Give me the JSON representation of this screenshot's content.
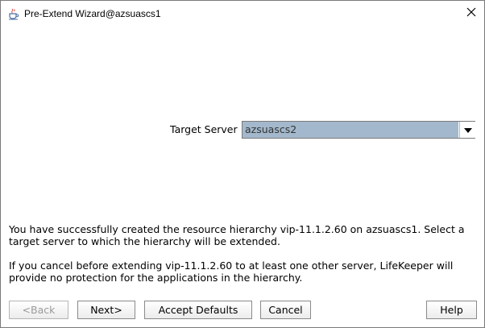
{
  "window": {
    "title": "Pre-Extend Wizard@azsuascs1",
    "app_icon": "java-coffee-cup-icon",
    "close_icon": "close-icon"
  },
  "form": {
    "target_server_label": "Target Server",
    "target_server_value": "azsuascs2",
    "dropdown_icon": "chevron-down-icon"
  },
  "messages": {
    "success": "You have successfully created the resource hierarchy vip-11.1.2.60 on azsuascs1. Select a target server to which the hierarchy will be extended.",
    "warning": "If you cancel before extending vip-11.1.2.60 to at least one other server, LifeKeeper will provide no protection for the applications in the hierarchy."
  },
  "buttons": {
    "back": "<Back",
    "next": "Next>",
    "accept_defaults": "Accept Defaults",
    "cancel": "Cancel",
    "help": "Help"
  },
  "colors": {
    "selection_bg": "#a3b8cc",
    "disabled_text": "#9a9a9a"
  }
}
